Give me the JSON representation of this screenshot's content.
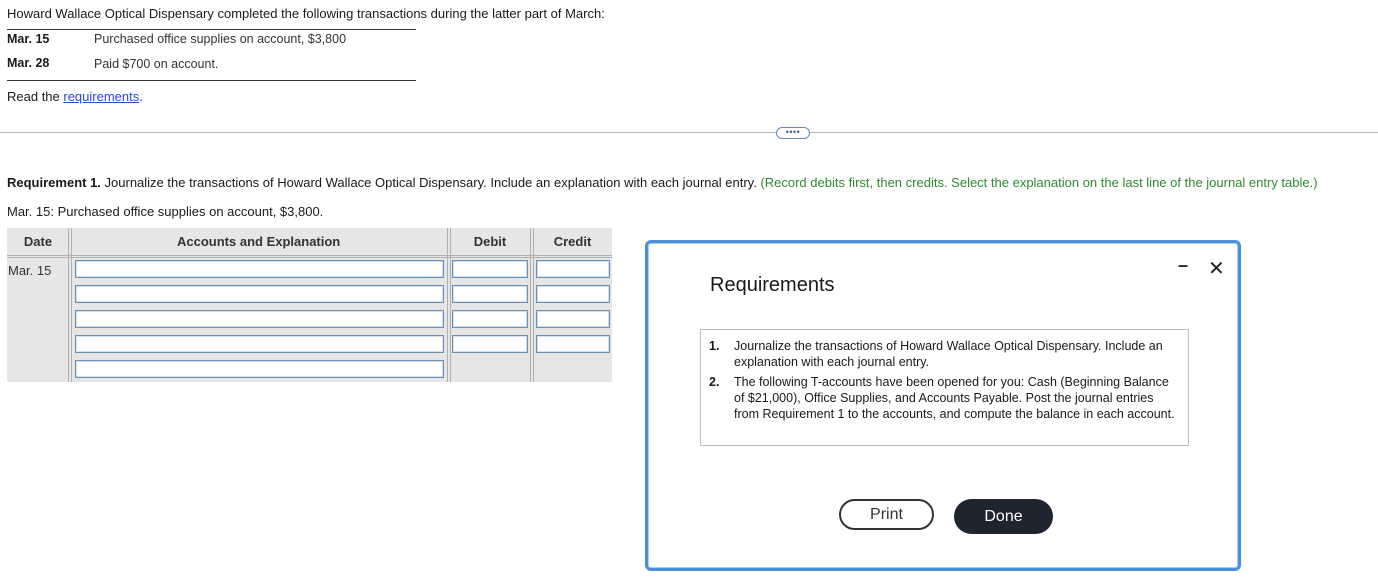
{
  "intro": "Howard Wallace Optical Dispensary completed the following transactions during the latter part of March:",
  "transactions": [
    {
      "date": "Mar. 15",
      "description": "Purchased office supplies on account, $3,800"
    },
    {
      "date": "Mar. 28",
      "description": "Paid $700 on account."
    }
  ],
  "read_prefix": "Read the ",
  "read_link": "requirements",
  "read_suffix": ".",
  "expand_label": "••••",
  "requirement1": {
    "label": "Requirement 1.",
    "text": " Journalize the transactions of Howard Wallace Optical Dispensary. Include an explanation with each journal entry. ",
    "hint": "(Record debits first, then credits. Select the explanation on the last line of the journal entry table.)"
  },
  "sub_label": "Mar. 15: Purchased office supplies on account, $3,800.",
  "journal": {
    "headers": {
      "date": "Date",
      "accounts": "Accounts and Explanation",
      "debit": "Debit",
      "credit": "Credit"
    },
    "date_value": "Mar. 15"
  },
  "dialog": {
    "title": "Requirements",
    "minimize": "–",
    "close": "✕",
    "items": [
      {
        "num": "1.",
        "text": "Journalize the transactions of Howard Wallace Optical Dispensary. Include an explanation with each journal entry."
      },
      {
        "num": "2.",
        "text": "The following T-accounts have been opened for you: Cash (Beginning Balance of $21,000), Office Supplies, and Accounts Payable. Post the journal entries from Requirement 1 to the accounts, and compute the balance in each account."
      }
    ],
    "print_label": "Print",
    "done_label": "Done"
  },
  "colors": {
    "hint_green": "#2e8b2e",
    "link_blue": "#1a4fd6",
    "dialog_border": "#4a90d9",
    "done_bg": "#1e2430"
  }
}
